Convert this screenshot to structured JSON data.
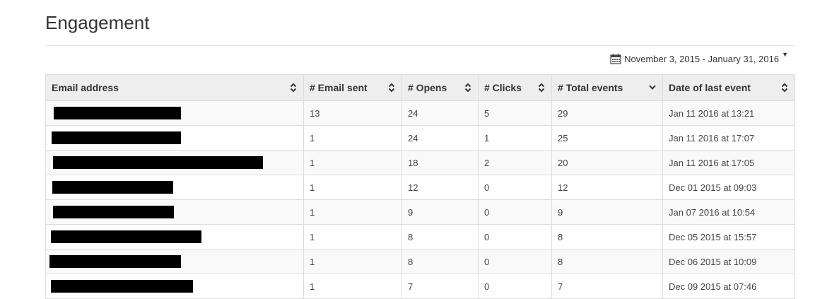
{
  "page": {
    "title": "Engagement"
  },
  "date_range": {
    "label": "November 3, 2015 - January 31, 2016"
  },
  "table": {
    "columns": [
      {
        "label": "Email address",
        "sort": "both"
      },
      {
        "label": "# Email sent",
        "sort": "both"
      },
      {
        "label": "# Opens",
        "sort": "both"
      },
      {
        "label": "# Clicks",
        "sort": "both"
      },
      {
        "label": "# Total events",
        "sort": "desc"
      },
      {
        "label": "Date of last event",
        "sort": "both"
      }
    ],
    "rows": [
      {
        "email": "",
        "sent": "13",
        "opens": "24",
        "clicks": "5",
        "total": "29",
        "last": "Jan 11 2016 at 13:21"
      },
      {
        "email": "",
        "sent": "1",
        "opens": "24",
        "clicks": "1",
        "total": "25",
        "last": "Jan 11 2016 at 17:07"
      },
      {
        "email": "",
        "sent": "1",
        "opens": "18",
        "clicks": "2",
        "total": "20",
        "last": "Jan 11 2016 at 17:05"
      },
      {
        "email": "",
        "sent": "1",
        "opens": "12",
        "clicks": "0",
        "total": "12",
        "last": "Dec 01 2015 at 09:03"
      },
      {
        "email": "",
        "sent": "1",
        "opens": "9",
        "clicks": "0",
        "total": "9",
        "last": "Jan 07 2016 at 10:54"
      },
      {
        "email": "",
        "sent": "1",
        "opens": "8",
        "clicks": "0",
        "total": "8",
        "last": "Dec 05 2015 at 15:57"
      },
      {
        "email": "",
        "sent": "1",
        "opens": "8",
        "clicks": "0",
        "total": "8",
        "last": "Dec 06 2015 at 10:09"
      },
      {
        "email": "",
        "sent": "1",
        "opens": "7",
        "clicks": "0",
        "total": "7",
        "last": "Dec 09 2015 at 07:46"
      }
    ]
  },
  "icons": {
    "calendar": "calendar-icon",
    "caret": "caret-down-icon",
    "sort_both": "sort-icon",
    "sort_desc": "sort-desc-icon"
  },
  "colors": {
    "header_bg": "#eeeeee",
    "border": "#dddddd",
    "stripe": "#f9f9f9",
    "redaction": "#000000"
  }
}
